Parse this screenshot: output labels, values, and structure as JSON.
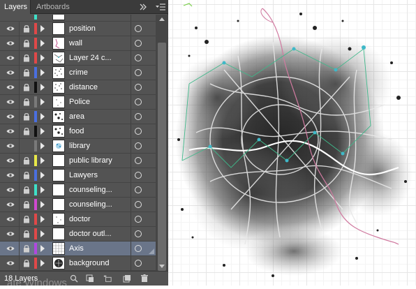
{
  "panel": {
    "tabs": [
      {
        "label": "Layers"
      },
      {
        "label": "Artboards"
      }
    ],
    "layers": [
      {
        "name": "position",
        "color": "#e04848",
        "visible": true,
        "locked": true,
        "thumb": "blank"
      },
      {
        "name": "wall",
        "color": "#e04848",
        "visible": true,
        "locked": true,
        "thumb": "wall"
      },
      {
        "name": "Layer 24 c...",
        "color": "#e04848",
        "visible": true,
        "locked": true,
        "thumb": "lines"
      },
      {
        "name": "crime",
        "color": "#4a6fe0",
        "visible": true,
        "locked": true,
        "thumb": "dots"
      },
      {
        "name": "distance",
        "color": "#111111",
        "visible": true,
        "locked": true,
        "thumb": "dots"
      },
      {
        "name": "Police",
        "color": "#7a7a7a",
        "visible": true,
        "locked": true,
        "thumb": "sparse"
      },
      {
        "name": "area",
        "color": "#4a6fe0",
        "visible": true,
        "locked": true,
        "thumb": "blobs"
      },
      {
        "name": "food",
        "color": "#111111",
        "visible": true,
        "locked": true,
        "thumb": "blobs"
      },
      {
        "name": "library",
        "color": "#7a7a7a",
        "visible": true,
        "locked": false,
        "thumb": "blue"
      },
      {
        "name": "public library",
        "color": "#e8e848",
        "visible": true,
        "locked": true,
        "thumb": "blank"
      },
      {
        "name": "Lawyers",
        "color": "#4a6fe0",
        "visible": true,
        "locked": true,
        "thumb": "blank"
      },
      {
        "name": "counseling...",
        "color": "#3ee0c8",
        "visible": true,
        "locked": true,
        "thumb": "blank"
      },
      {
        "name": "counseling...",
        "color": "#d048d0",
        "visible": true,
        "locked": true,
        "thumb": "blank"
      },
      {
        "name": "doctor",
        "color": "#e04848",
        "visible": true,
        "locked": true,
        "thumb": "sparse"
      },
      {
        "name": "doctor outl...",
        "color": "#e04848",
        "visible": true,
        "locked": true,
        "thumb": "blank"
      },
      {
        "name": "Axis",
        "color": "#b048e0",
        "visible": true,
        "locked": true,
        "thumb": "grid",
        "selected": true
      },
      {
        "name": "background",
        "color": "#e04848",
        "visible": true,
        "locked": true,
        "thumb": "map"
      }
    ],
    "layer_count": "18 Layers",
    "watermark": "ate Windows"
  },
  "icons": {
    "visibility": "eye-icon",
    "lock": "lock-icon",
    "expand": "disclosure-triangle-icon",
    "target": "target-circle-icon",
    "menu": "panel-menu-icon",
    "collapse": "double-chevron-icon"
  }
}
